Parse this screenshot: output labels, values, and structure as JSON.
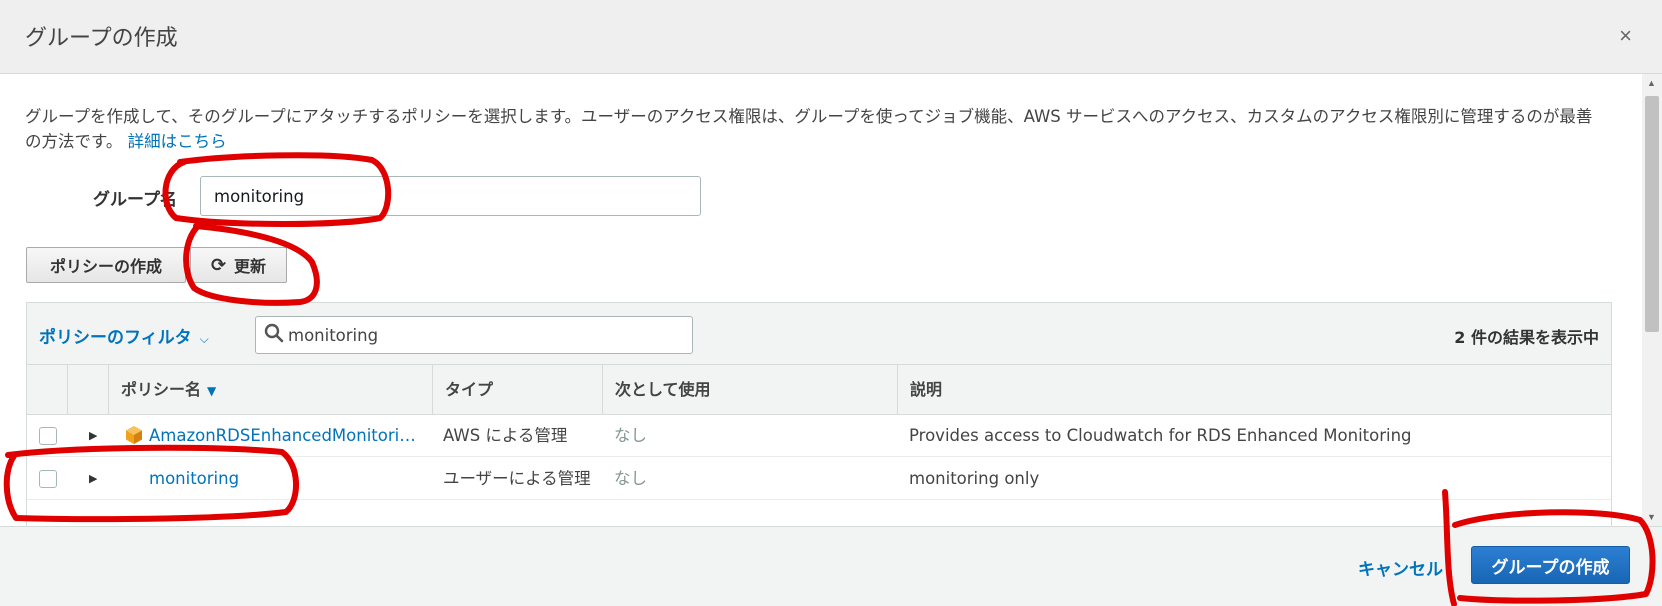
{
  "modal": {
    "title": "グループの作成",
    "close_glyph": "×"
  },
  "body": {
    "description": "グループを作成して、そのグループにアタッチするポリシーを選択します。ユーザーのアクセス権限は、グループを使ってジョブ機能、AWS サービスへのアクセス、カスタムのアクセス権限別に管理するのが最善の方法です。",
    "learn_more": "詳細はこちら",
    "group_name_label": "グループ名",
    "group_name_value": "monitoring"
  },
  "toolbar": {
    "create_policy_label": "ポリシーの作成",
    "refresh_label": "更新",
    "refresh_icon": "refresh-icon"
  },
  "filter": {
    "filter_label": "ポリシーのフィルタ",
    "search_value": "monitoring",
    "result_count": "2 件の結果を表示中"
  },
  "table": {
    "columns": [
      "ポリシー名",
      "タイプ",
      "次として使用",
      "説明"
    ],
    "rows": [
      {
        "name": "AmazonRDSEnhancedMonitoring…",
        "type": "AWS による管理",
        "used_as": "なし",
        "description": "Provides access to Cloudwatch for RDS Enhanced Monitoring",
        "icon": "aws-managed-icon"
      },
      {
        "name": "monitoring",
        "type": "ユーザーによる管理",
        "used_as": "なし",
        "description": "monitoring only"
      }
    ]
  },
  "footer": {
    "cancel_label": "キャンセル",
    "create_group_label": "グループの作成"
  },
  "colors": {
    "link": "#0073bb",
    "primary_button": "#1f6fc5",
    "annotation": "#e00000"
  }
}
